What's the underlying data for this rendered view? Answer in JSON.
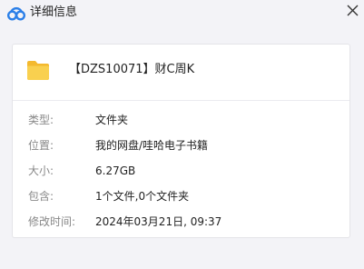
{
  "window": {
    "title": "详细信息",
    "logo_icon": "cloud-logo-icon",
    "close_icon": "close-icon"
  },
  "file": {
    "icon": "folder-icon",
    "name": "【DZS10071】财C周K"
  },
  "details": [
    {
      "label": "类型:",
      "value": "文件夹"
    },
    {
      "label": "位置:",
      "value": "我的网盘/哇哈电子书籍"
    },
    {
      "label": "大小:",
      "value": "6.27GB"
    },
    {
      "label": "包含:",
      "value": "1个文件,0个文件夹"
    },
    {
      "label": "修改时间:",
      "value": "2024年03月21日, 09:37"
    }
  ],
  "colors": {
    "background": "#f3f3f7",
    "card": "#ffffff",
    "label": "#888888",
    "folder": "#f7c844",
    "logo_blue": "#2b7fe8"
  }
}
